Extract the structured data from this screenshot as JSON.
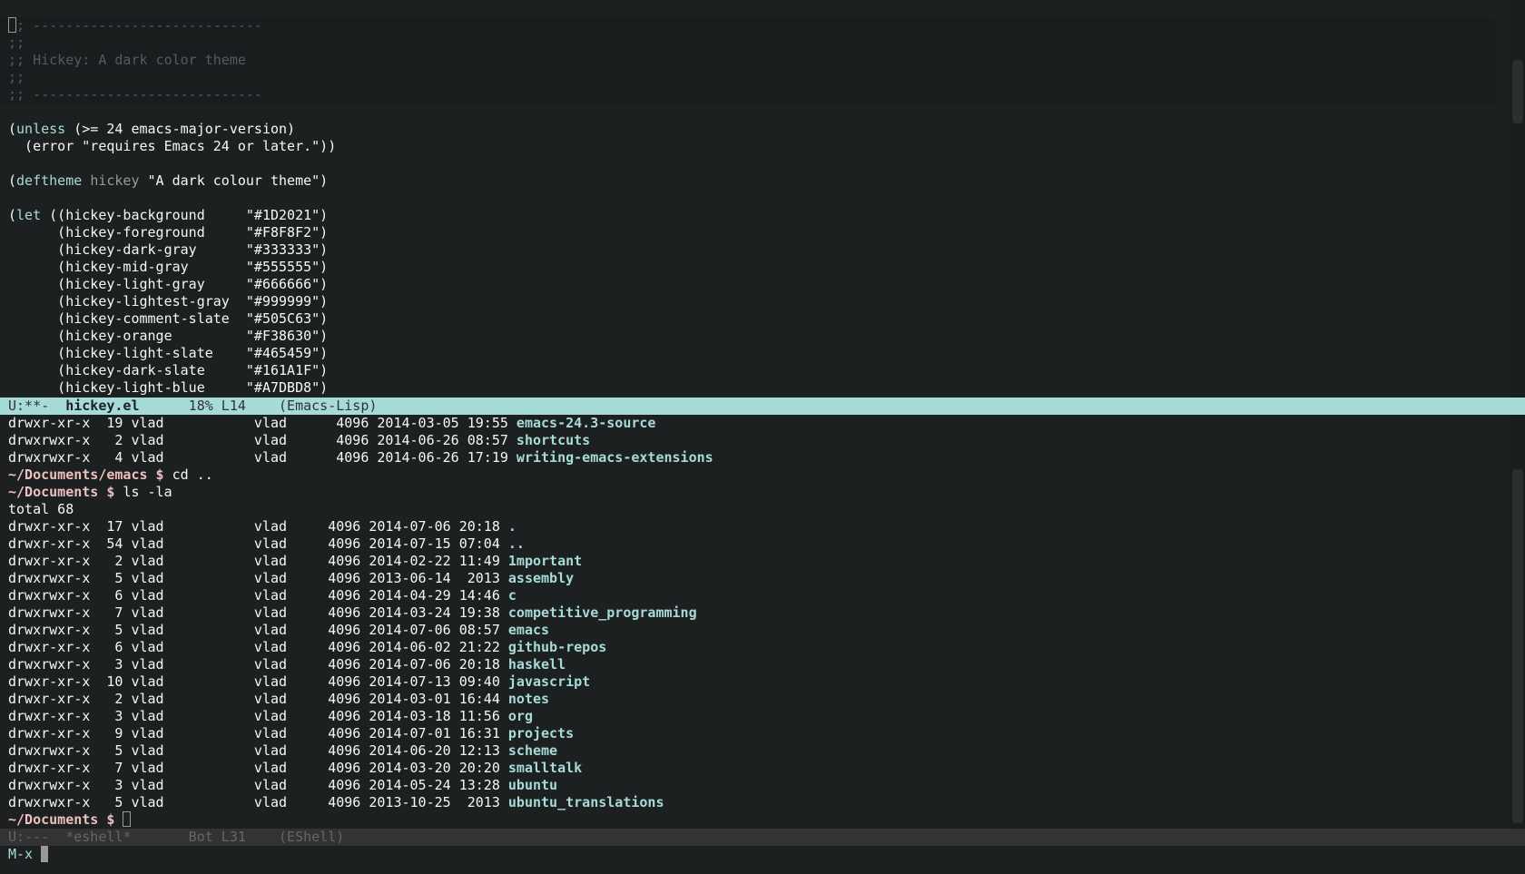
{
  "editor": {
    "comment_lines": [
      "; ----------------------------",
      ";;",
      ";; Hickey: A dark color theme",
      ";;",
      ";; ----------------------------"
    ],
    "unless_kw": "unless",
    "unless_rest": " (>= 24 emacs-major-version)",
    "error_line": "  (error \"requires Emacs 24 or later.\"))",
    "deftheme_kw": "deftheme",
    "deftheme_name": "hickey",
    "deftheme_rest": " \"A dark colour theme\")",
    "let_kw": "let",
    "let_lines": [
      " ((hickey-background     \"#1D2021\")",
      "      (hickey-foreground     \"#F8F8F2\")",
      "      (hickey-dark-gray      \"#333333\")",
      "      (hickey-mid-gray       \"#555555\")",
      "      (hickey-light-gray     \"#666666\")",
      "      (hickey-lightest-gray  \"#999999\")",
      "      (hickey-comment-slate  \"#505C63\")",
      "      (hickey-orange         \"#F38630\")",
      "      (hickey-light-slate    \"#465459\")",
      "      (hickey-dark-slate     \"#161A1F\")",
      "      (hickey-light-blue     \"#A7DBD8\")"
    ]
  },
  "modeline_active": {
    "status": "U:**-  ",
    "buffer": "hickey.el",
    "position": "      18% L14    ",
    "mode": "(Emacs-Lisp)"
  },
  "shell": {
    "top_rows": [
      {
        "meta": "drwxr-xr-x  19 vlad           vlad      4096 2014-03-05 19:55 ",
        "name": "emacs-24.3-source"
      },
      {
        "meta": "drwxrwxr-x   2 vlad           vlad      4096 2014-06-26 08:57 ",
        "name": "shortcuts"
      },
      {
        "meta": "drwxrwxr-x   4 vlad           vlad      4096 2014-06-26 17:19 ",
        "name": "writing-emacs-extensions"
      }
    ],
    "cmd1_prompt": "~/Documents/emacs $ ",
    "cmd1": "cd ..",
    "cmd2_prompt": "~/Documents $ ",
    "cmd2": "ls -la",
    "total": "total 68",
    "rows": [
      {
        "meta": "drwxr-xr-x  17 vlad           vlad     4096 2014-07-06 20:18 ",
        "name": "."
      },
      {
        "meta": "drwxr-xr-x  54 vlad           vlad     4096 2014-07-15 07:04 ",
        "name": ".."
      },
      {
        "meta": "drwxr-xr-x   2 vlad           vlad     4096 2014-02-22 11:49 ",
        "name": "1mportant"
      },
      {
        "meta": "drwxrwxr-x   5 vlad           vlad     4096 2013-06-14  2013 ",
        "name": "assembly"
      },
      {
        "meta": "drwxrwxr-x   6 vlad           vlad     4096 2014-04-29 14:46 ",
        "name": "c"
      },
      {
        "meta": "drwxrwxr-x   7 vlad           vlad     4096 2014-03-24 19:38 ",
        "name": "competitive_programming"
      },
      {
        "meta": "drwxrwxr-x   5 vlad           vlad     4096 2014-07-06 08:57 ",
        "name": "emacs"
      },
      {
        "meta": "drwxr-xr-x   6 vlad           vlad     4096 2014-06-02 21:22 ",
        "name": "github-repos"
      },
      {
        "meta": "drwxrwxr-x   3 vlad           vlad     4096 2014-07-06 20:18 ",
        "name": "haskell"
      },
      {
        "meta": "drwxr-xr-x  10 vlad           vlad     4096 2014-07-13 09:40 ",
        "name": "javascript"
      },
      {
        "meta": "drwxr-xr-x   2 vlad           vlad     4096 2014-03-01 16:44 ",
        "name": "notes"
      },
      {
        "meta": "drwxr-xr-x   3 vlad           vlad     4096 2014-03-18 11:56 ",
        "name": "org"
      },
      {
        "meta": "drwxr-xr-x   9 vlad           vlad     4096 2014-07-01 16:31 ",
        "name": "projects"
      },
      {
        "meta": "drwxrwxr-x   5 vlad           vlad     4096 2014-06-20 12:13 ",
        "name": "scheme"
      },
      {
        "meta": "drwxr-xr-x   7 vlad           vlad     4096 2014-03-20 20:20 ",
        "name": "smalltalk"
      },
      {
        "meta": "drwxrwxr-x   3 vlad           vlad     4096 2014-05-24 13:28 ",
        "name": "ubuntu"
      },
      {
        "meta": "drwxrwxr-x   5 vlad           vlad     4096 2013-10-25  2013 ",
        "name": "ubuntu_translations"
      }
    ],
    "final_prompt": "~/Documents $ "
  },
  "modeline_inactive": {
    "status": "U:---  ",
    "buffer": "*eshell*",
    "position": "       Bot L31    ",
    "mode": "(EShell)"
  },
  "minibuffer": {
    "prompt": "M-x "
  },
  "colors": {
    "background": "#1D2021",
    "foreground": "#F8F8F2",
    "light_blue": "#A7DBD8",
    "comment": "#505C63",
    "modeline_inactive": "#333333"
  }
}
